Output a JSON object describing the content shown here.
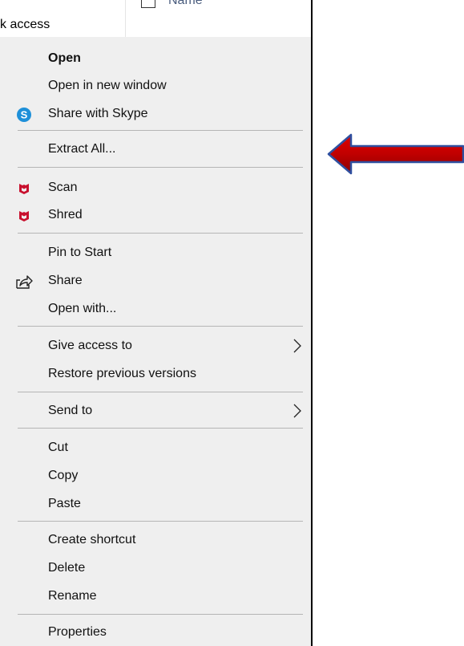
{
  "explorer": {
    "quick_access_label": "k access",
    "column_name": "Name"
  },
  "menu": {
    "items": [
      {
        "label": "Open",
        "bold": true
      },
      {
        "label": "Open in new window"
      },
      {
        "label": "Share with Skype",
        "icon": "skype-icon"
      },
      {
        "label": "Extract All..."
      },
      {
        "label": "Scan",
        "icon": "mcafee-icon"
      },
      {
        "label": "Shred",
        "icon": "mcafee-icon"
      },
      {
        "label": "Pin to Start"
      },
      {
        "label": "Share",
        "icon": "share-icon"
      },
      {
        "label": "Open with..."
      },
      {
        "label": "Give access to",
        "submenu": true
      },
      {
        "label": "Restore previous versions"
      },
      {
        "label": "Send to",
        "submenu": true
      },
      {
        "label": "Cut"
      },
      {
        "label": "Copy"
      },
      {
        "label": "Paste"
      },
      {
        "label": "Create shortcut"
      },
      {
        "label": "Delete"
      },
      {
        "label": "Rename"
      },
      {
        "label": "Properties"
      }
    ]
  },
  "icons": {
    "skype_letter": "S",
    "skype_color": "#1e90d9",
    "mcafee_color": "#c8102e"
  },
  "annotation": {
    "arrow_color": "#c00000",
    "arrow_outline": "#2f4f9f",
    "arrow_direction": "left"
  }
}
